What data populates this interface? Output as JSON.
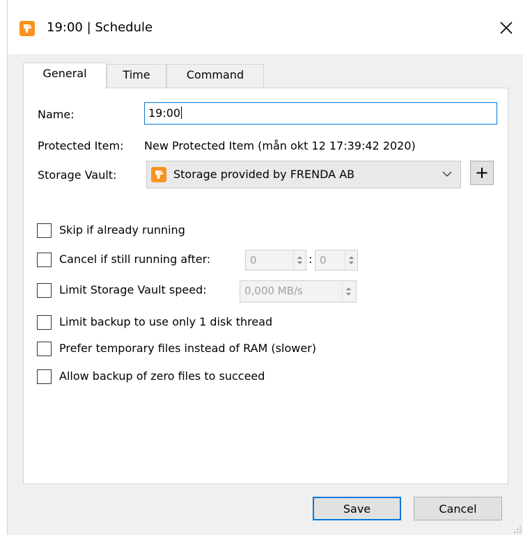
{
  "window": {
    "title": "19:00 | Schedule",
    "app_icon": "app-icon",
    "accent_color": "#0078d7",
    "icon_color": "#f7931e"
  },
  "tabs": [
    {
      "label": "General",
      "active": true
    },
    {
      "label": "Time",
      "active": false
    },
    {
      "label": "Command",
      "active": false
    }
  ],
  "general": {
    "name_label": "Name:",
    "name_value": "19:00",
    "protected_item_label": "Protected Item:",
    "protected_item_value": "New Protected Item (mån okt 12 17:39:42 2020)",
    "storage_vault_label": "Storage Vault:",
    "storage_vault_value": "Storage provided by FRENDA AB",
    "add_vault_label": "+"
  },
  "options": [
    {
      "label": "Skip if already running",
      "checked": false
    },
    {
      "label": "Cancel if still running after:",
      "checked": false
    },
    {
      "label": "Limit Storage Vault speed:",
      "checked": false
    },
    {
      "label": "Limit backup to use only 1 disk thread",
      "checked": false
    },
    {
      "label": "Prefer temporary files instead of RAM (slower)",
      "checked": false
    },
    {
      "label": "Allow backup of zero files to succeed",
      "checked": false
    }
  ],
  "cancel_after": {
    "hours": "0",
    "separator": ":",
    "minutes": "0"
  },
  "speed_limit": {
    "value": "0,000 MB/s"
  },
  "buttons": {
    "save": "Save",
    "cancel": "Cancel"
  }
}
